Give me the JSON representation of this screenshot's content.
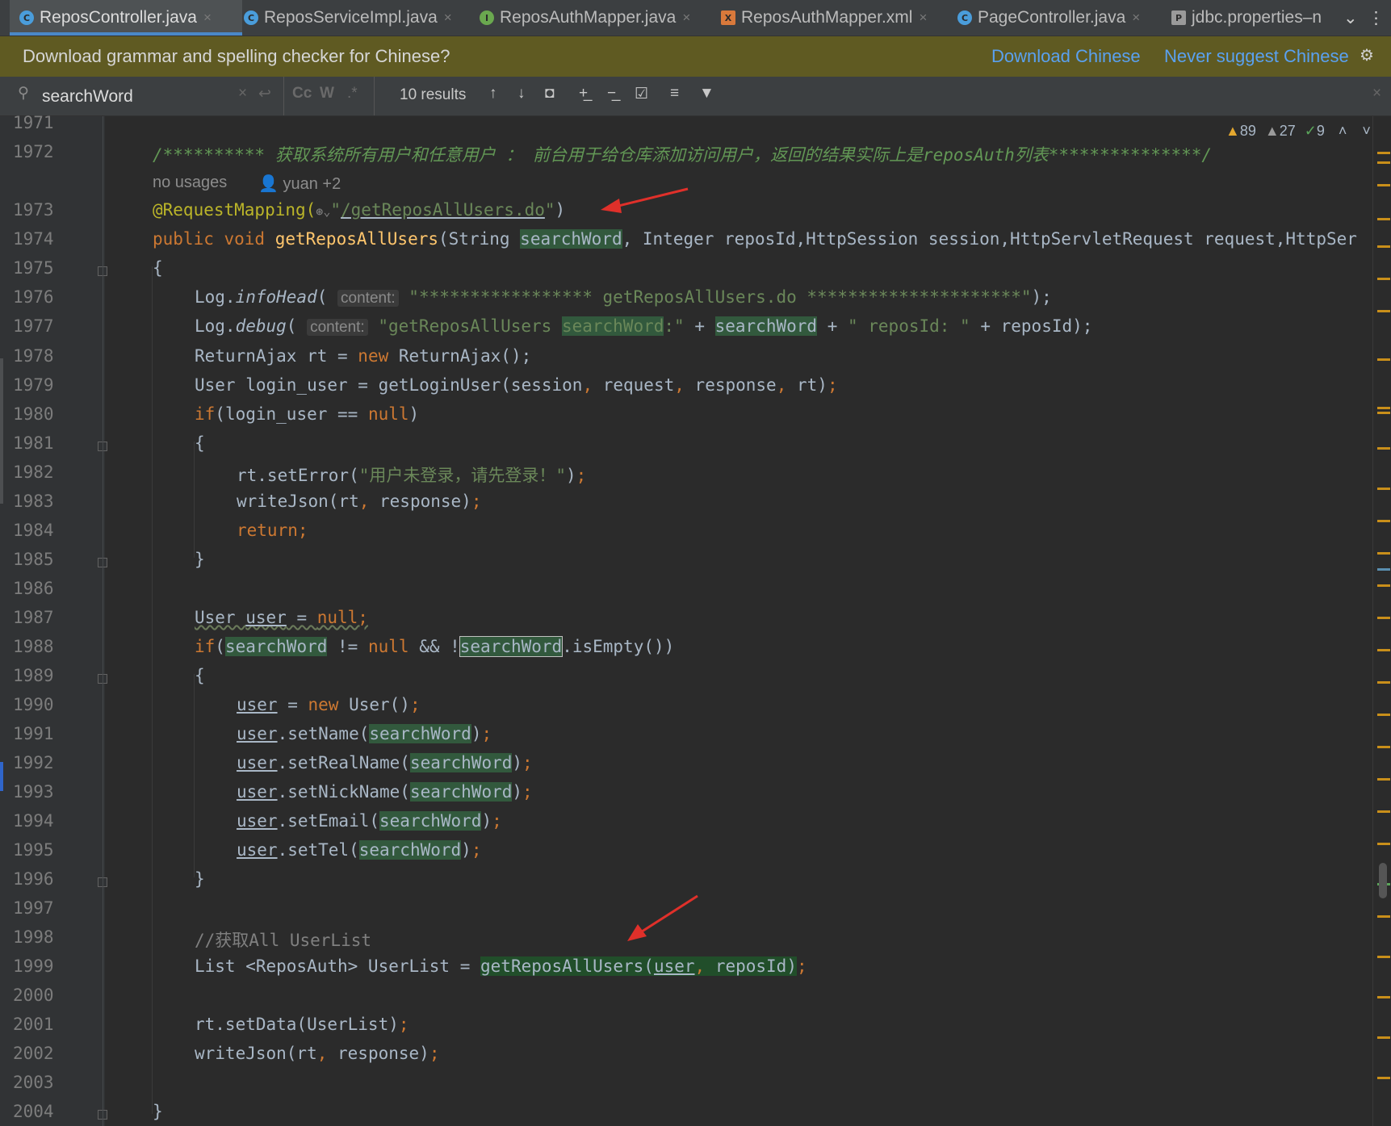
{
  "tabs": [
    {
      "label": "ReposController.java",
      "icon": "C",
      "color": "#4a9ddb",
      "active": true
    },
    {
      "label": "ReposServiceImpl.java",
      "icon": "C",
      "color": "#4a9ddb",
      "active": false
    },
    {
      "label": "ReposAuthMapper.java",
      "icon": "I",
      "color": "#6aa84f",
      "active": false
    },
    {
      "label": "ReposAuthMapper.xml",
      "icon": "X",
      "color": "#d9793b",
      "active": false
    },
    {
      "label": "PageController.java",
      "icon": "C",
      "color": "#4a9ddb",
      "active": false
    },
    {
      "label": "jdbc.properties–n",
      "icon": "P",
      "color": "#9a9a9a",
      "active": false
    }
  ],
  "notification": {
    "message": "Download grammar and spelling checker for Chinese?",
    "download_link": "Download Chinese",
    "never_link": "Never suggest Chinese"
  },
  "find": {
    "query": "searchWord",
    "results": "10 results",
    "options": [
      "Cc",
      "W",
      ".*"
    ]
  },
  "inspections": {
    "warnings": "89",
    "weak_warnings": "27",
    "ok": "9"
  },
  "colors": {
    "keyword": "#cc7832",
    "string": "#6a8759",
    "annotation": "#bbb529",
    "method": "#ffc66d",
    "search_highlight": "#32593d",
    "arrow": "#e0302a"
  },
  "code": {
    "line_numbers": [
      "1971",
      "1972",
      "1973",
      "1974",
      "1975",
      "1976",
      "1977",
      "1978",
      "1979",
      "1980",
      "1981",
      "1982",
      "1983",
      "1984",
      "1985",
      "1986",
      "1987",
      "1988",
      "1989",
      "1990",
      "1991",
      "1992",
      "1993",
      "1994",
      "1995",
      "1996",
      "1997",
      "1998",
      "1999",
      "2000",
      "2001",
      "2002",
      "2003",
      "2004"
    ],
    "javadoc": "/********** 获取系统所有用户和任意用户 ： 前台用于给仓库添加访问用户，返回的结果实际上是reposAuth列表***************/",
    "usages": "no usages",
    "author": "yuan +2",
    "annotation": "@RequestMapping(",
    "mapping_path": "/getReposAllUsers.do",
    "signature_tail": ", Integer reposId,HttpSession session,HttpServletRequest request,HttpSer",
    "hint_content": "content:",
    "log_head_str": "\"***************** getReposAllUsers.do *********************\"",
    "log_debug_str_a": "\"getReposAllUsers ",
    "log_debug_str_b": ":\"",
    "log_debug_str_c": "\" reposId: \"",
    "error_str": "\"用户未登录，请先登录！\"",
    "comment_line": "//获取All UserList",
    "search_word": "searchWord"
  }
}
